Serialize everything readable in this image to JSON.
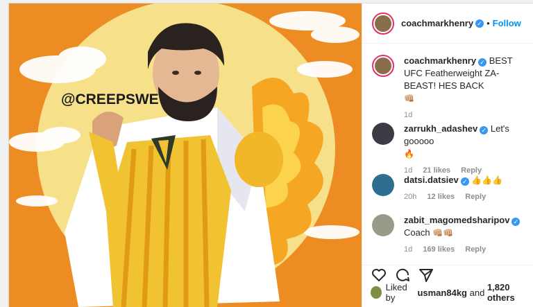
{
  "post": {
    "author": "coachmarkhenry",
    "follow_label": "Follow",
    "dot": "•",
    "caption_text": "BEST UFC Featherweight ZA-BEAST! HES BACK",
    "caption_emoji": "👊🏼",
    "caption_time": "1d",
    "image_watermark": "@CREEPSWE"
  },
  "comments": [
    {
      "user": "zarrukh_adashev",
      "text": "Let's gooooo",
      "emoji": "🔥",
      "time": "1d",
      "likes": "21 likes",
      "reply": "Reply"
    },
    {
      "user": "datsi.datsiev",
      "text": "",
      "emoji": "👍👍👍",
      "time": "20h",
      "likes": "12 likes",
      "reply": "Reply"
    },
    {
      "user": "zabit_magomedsharipov",
      "text": "Coach",
      "emoji": "👊🏼👊🏼",
      "time": "1d",
      "likes": "169 likes",
      "reply": "Reply"
    }
  ],
  "likes": {
    "prefix": "Liked by",
    "user": "usman84kg",
    "suffix": "and",
    "others": "1,820 others"
  },
  "colors": {
    "accent": "#0095f6",
    "verified": "#3897f0",
    "orange": "#ee8c24",
    "sun": "#f6e08a"
  },
  "icons": [
    "verified-badge-icon",
    "heart-icon",
    "comment-icon",
    "share-icon"
  ]
}
